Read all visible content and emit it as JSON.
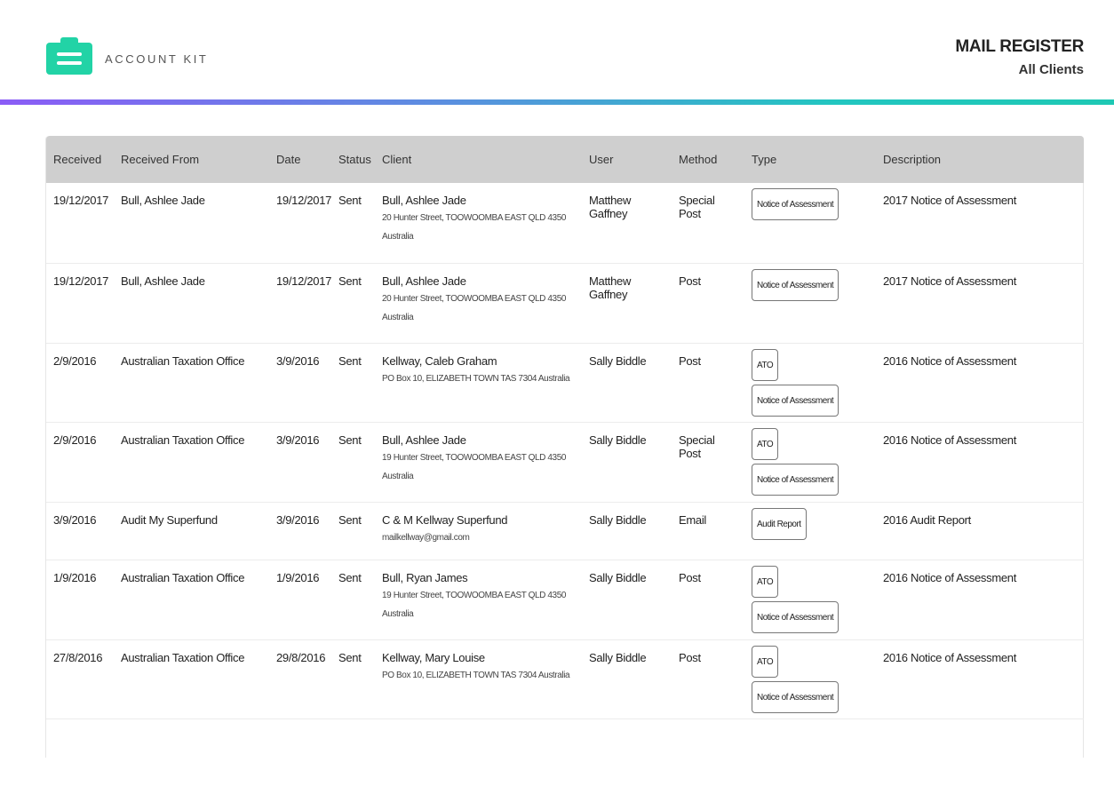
{
  "header": {
    "brand": "ACCOUNT KIT",
    "title": "MAIL REGISTER",
    "subtitle": "All Clients"
  },
  "colors": {
    "accent": "#22d3a6",
    "header_row": "#cfcfcf"
  },
  "table": {
    "columns": [
      "Received",
      "Received From",
      "Date",
      "Status",
      "Client",
      "User",
      "Method",
      "Type",
      "Description"
    ],
    "rows": [
      {
        "received": "19/12/2017",
        "from": "Bull, Ashlee Jade",
        "date": "19/12/2017",
        "status": "Sent",
        "client": "Bull, Ashlee Jade",
        "address1": "20 Hunter Street, TOOWOOMBA EAST QLD 4350",
        "address2": "Australia",
        "user": "Matthew Gaffney",
        "method": "Special Post",
        "types": [
          "Notice of Assessment"
        ],
        "description": "2017 Notice of Assessment"
      },
      {
        "received": "19/12/2017",
        "from": "Bull, Ashlee Jade",
        "date": "19/12/2017",
        "status": "Sent",
        "client": "Bull, Ashlee Jade",
        "address1": "20 Hunter Street, TOOWOOMBA EAST QLD 4350",
        "address2": "Australia",
        "user": "Matthew Gaffney",
        "method": "Post",
        "types": [
          "Notice of Assessment"
        ],
        "description": "2017 Notice of Assessment"
      },
      {
        "received": "2/9/2016",
        "from": "Australian Taxation Office",
        "date": "3/9/2016",
        "status": "Sent",
        "client": "Kellway, Caleb Graham",
        "address1": "PO Box 10, ELIZABETH TOWN TAS 7304 Australia",
        "address2": "",
        "user": "Sally Biddle",
        "method": "Post",
        "types": [
          "ATO",
          "Notice of Assessment"
        ],
        "description": "2016 Notice of Assessment"
      },
      {
        "received": "2/9/2016",
        "from": "Australian Taxation Office",
        "date": "3/9/2016",
        "status": "Sent",
        "client": "Bull, Ashlee Jade",
        "address1": "19 Hunter Street, TOOWOOMBA EAST QLD 4350",
        "address2": "Australia",
        "user": "Sally Biddle",
        "method": "Special Post",
        "types": [
          "ATO",
          "Notice of Assessment"
        ],
        "description": "2016 Notice of Assessment"
      },
      {
        "received": "3/9/2016",
        "from": "Audit My Superfund",
        "date": "3/9/2016",
        "status": "Sent",
        "client": "C & M Kellway Superfund",
        "address1": "mailkellway@gmail.com",
        "address2": "",
        "user": "Sally Biddle",
        "method": "Email",
        "types": [
          "Audit Report"
        ],
        "description": "2016 Audit Report"
      },
      {
        "received": "1/9/2016",
        "from": "Australian Taxation Office",
        "date": "1/9/2016",
        "status": "Sent",
        "client": "Bull, Ryan James",
        "address1": "19 Hunter Street, TOOWOOMBA EAST QLD 4350",
        "address2": "Australia",
        "user": "Sally Biddle",
        "method": "Post",
        "types": [
          "ATO",
          "Notice of Assessment"
        ],
        "description": "2016 Notice of Assessment"
      },
      {
        "received": "27/8/2016",
        "from": "Australian Taxation Office",
        "date": "29/8/2016",
        "status": "Sent",
        "client": "Kellway, Mary Louise",
        "address1": "PO Box 10, ELIZABETH TOWN TAS 7304 Australia",
        "address2": "",
        "user": "Sally Biddle",
        "method": "Post",
        "types": [
          "ATO",
          "Notice of Assessment"
        ],
        "description": "2016 Notice of Assessment"
      }
    ]
  }
}
